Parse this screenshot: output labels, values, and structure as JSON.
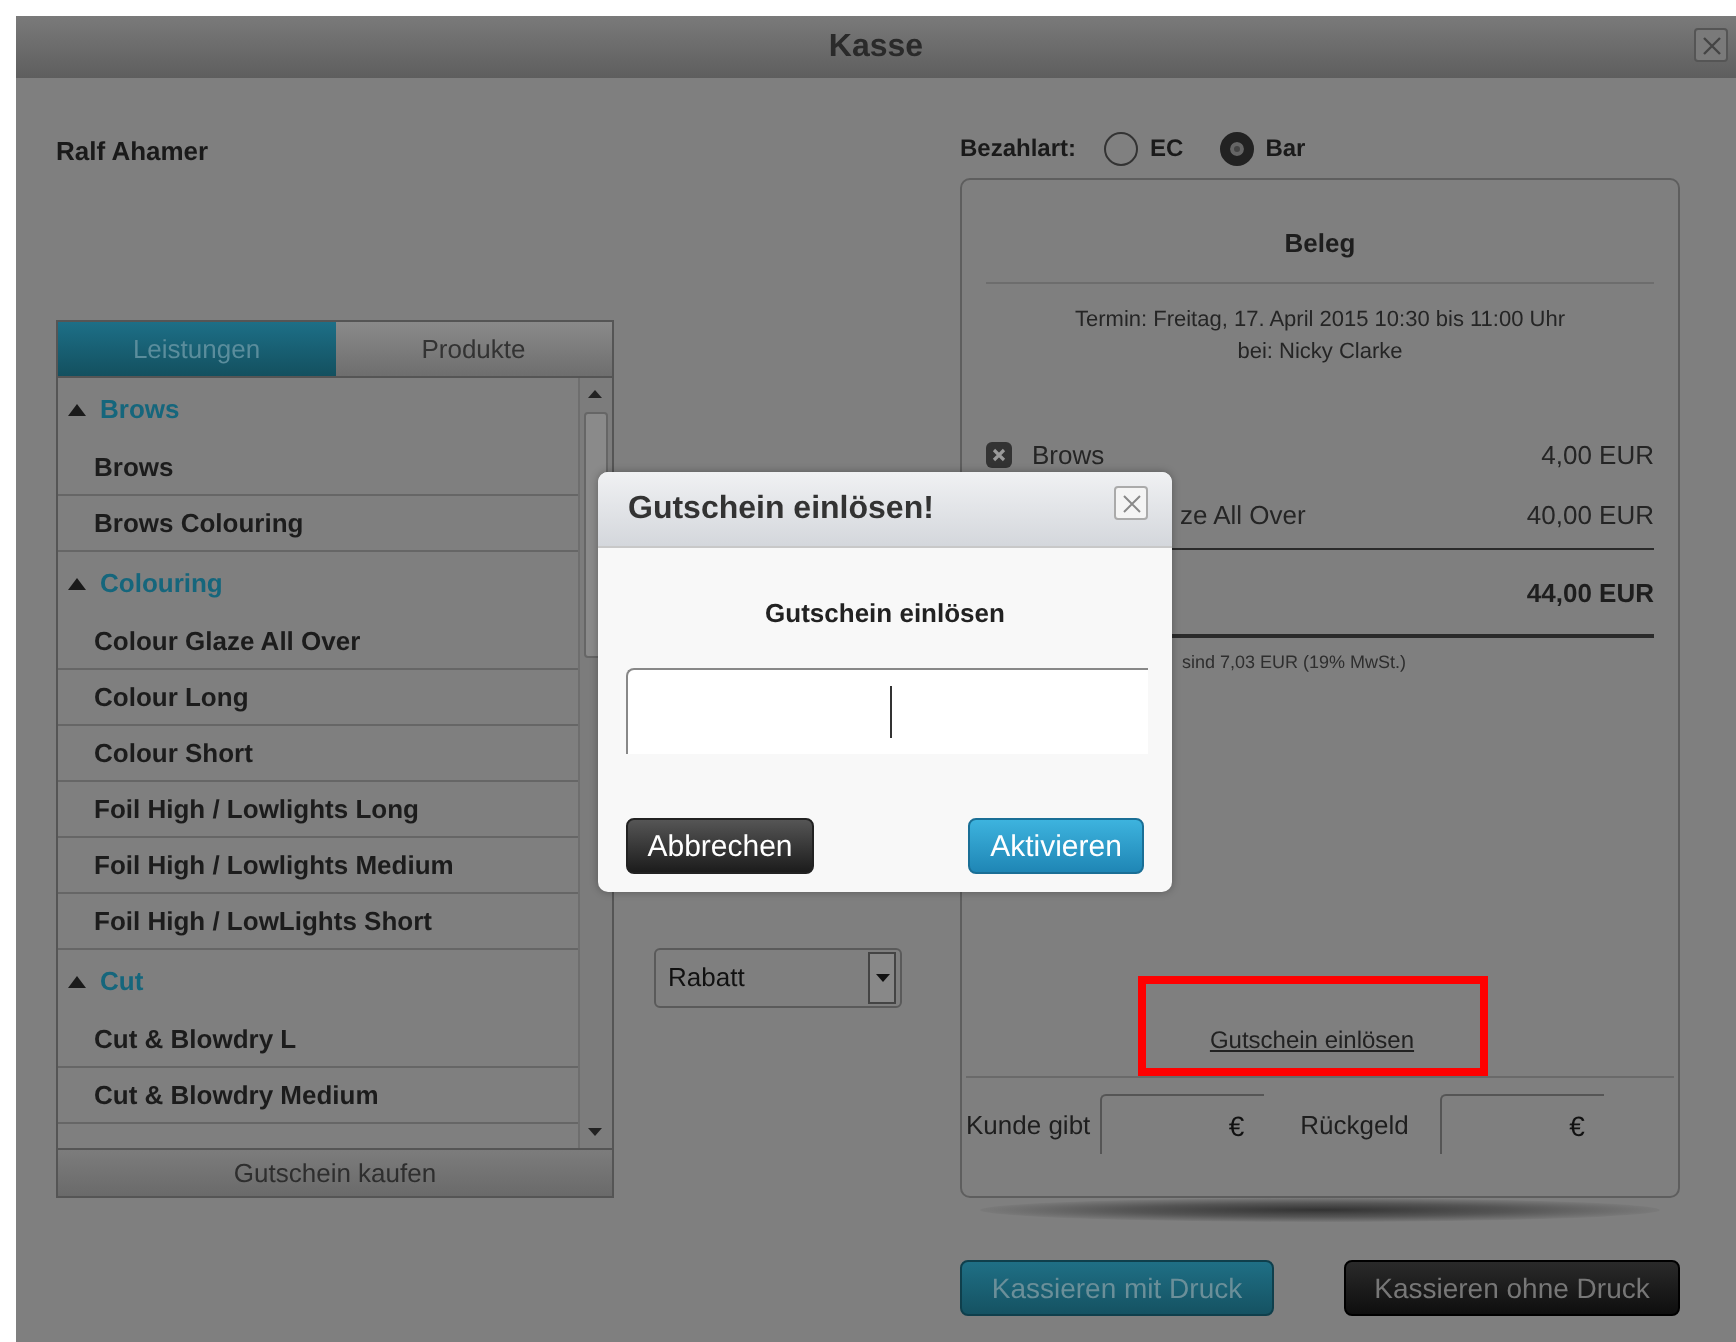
{
  "window": {
    "title": "Kasse"
  },
  "customer": "Ralf Ahamer",
  "tabs": [
    {
      "label": "Leistungen",
      "selected": true
    },
    {
      "label": "Produkte",
      "selected": false
    }
  ],
  "services": [
    {
      "group": "Brows",
      "expanded": true,
      "items": [
        "Brows",
        "Brows Colouring"
      ]
    },
    {
      "group": "Colouring",
      "expanded": true,
      "items": [
        "Colour Glaze All Over",
        "Colour Long",
        "Colour Short",
        "Foil High / Lowlights Long",
        "Foil High / Lowlights Medium",
        "Foil High / LowLights Short"
      ]
    },
    {
      "group": "Cut",
      "expanded": true,
      "items": [
        "Cut & Blowdry L",
        "Cut & Blowdry Medium"
      ]
    }
  ],
  "voucher_buy_button": "Gutschein kaufen",
  "discount_select": {
    "value": "Rabatt"
  },
  "payment": {
    "label": "Bezahlart:",
    "options": [
      {
        "label": "EC",
        "selected": false
      },
      {
        "label": "Bar",
        "selected": true
      }
    ]
  },
  "receipt": {
    "title": "Beleg",
    "appointment": "Termin: Freitag, 17. April 2015 10:30 bis 11:00 Uhr",
    "staff": "bei: Nicky Clarke",
    "items": [
      {
        "name": "Brows",
        "price": "4,00 EUR",
        "remove_icon": true,
        "clipped": false
      },
      {
        "name": "ze All Over",
        "price": "40,00 EUR",
        "remove_icon": false,
        "clipped": true
      }
    ],
    "total": "44,00 EUR",
    "tax_note": "sind 7,03 EUR (19% MwSt.)",
    "voucher_link": "Gutschein einlösen",
    "given_label": "Kunde gibt",
    "given_currency": "€",
    "change_label": "Rückgeld",
    "change_currency": "€"
  },
  "buttons": [
    {
      "label": "Kassieren mit Druck",
      "kind": "primary"
    },
    {
      "label": "Kassieren ohne Druck",
      "kind": "dark"
    }
  ],
  "dialog": {
    "title": "Gutschein einlösen!",
    "heading": "Gutschein einlösen",
    "buttons": [
      {
        "label": "Abbrechen",
        "kind": "dark"
      },
      {
        "label": "Aktivieren",
        "kind": "primary"
      }
    ]
  }
}
